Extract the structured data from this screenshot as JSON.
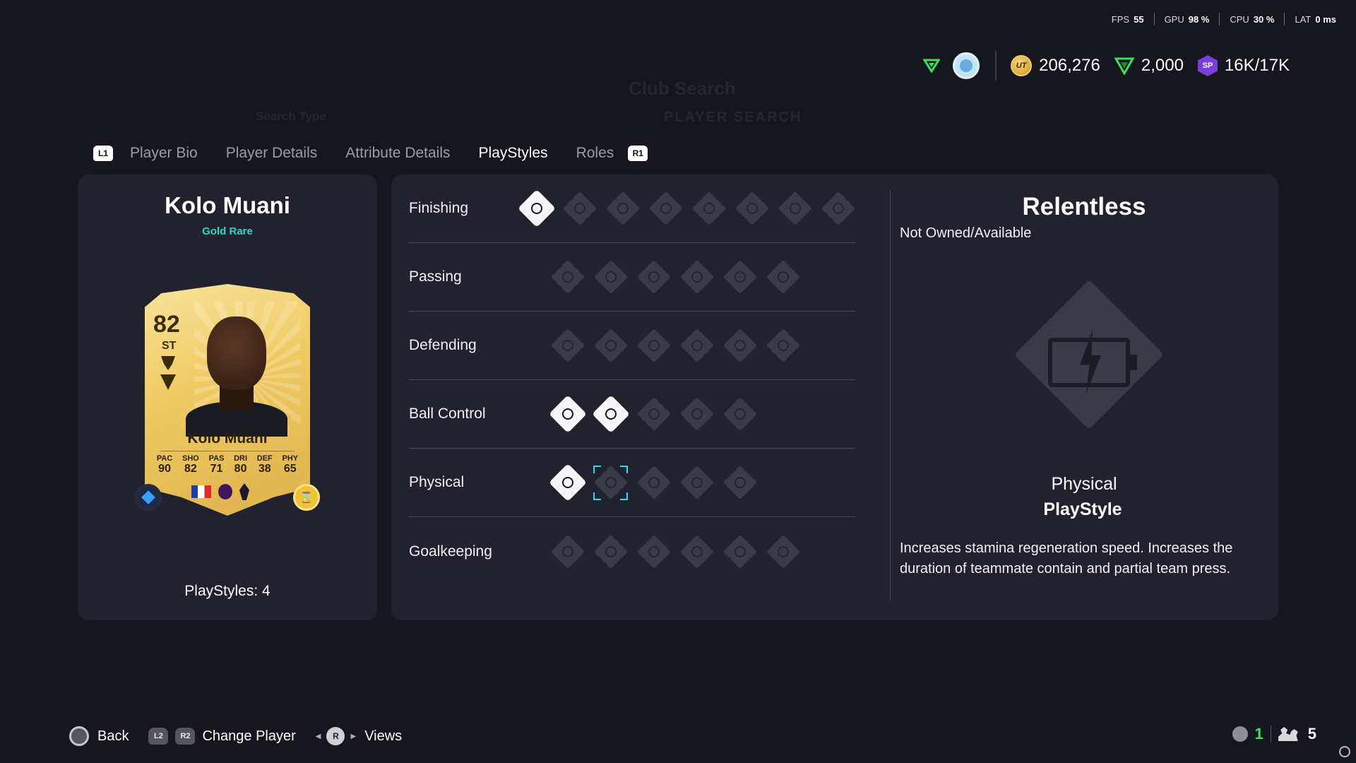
{
  "perf": {
    "fps_label": "FPS",
    "fps": "55",
    "gpu_label": "GPU",
    "gpu": "98 %",
    "cpu_label": "CPU",
    "cpu": "30 %",
    "lat_label": "LAT",
    "lat": "0 ms"
  },
  "ghost": {
    "title": "Club Search",
    "subtitle": "PLAYER SEARCH",
    "label": "Search Type"
  },
  "currency": {
    "coins_icon_text": "UT",
    "coins": "206,276",
    "points": "2,000",
    "sp_icon_text": "SP",
    "sp": "16K/17K"
  },
  "tabs": {
    "left_shoulder": "L1",
    "right_shoulder": "R1",
    "items": [
      "Player Bio",
      "Player Details",
      "Attribute Details",
      "PlayStyles",
      "Roles"
    ],
    "active": "PlayStyles"
  },
  "player": {
    "name": "Kolo Muani",
    "rarity": "Gold Rare",
    "playstyles_count": "PlayStyles: 4",
    "card": {
      "rating": "82",
      "position": "ST",
      "name": "Kolo Muani",
      "stats": [
        {
          "k": "PAC",
          "v": "90"
        },
        {
          "k": "SHO",
          "v": "82"
        },
        {
          "k": "PAS",
          "v": "71"
        },
        {
          "k": "DRI",
          "v": "80"
        },
        {
          "k": "DEF",
          "v": "38"
        },
        {
          "k": "PHY",
          "v": "65"
        }
      ]
    }
  },
  "categories": [
    {
      "label": "Finishing",
      "count": 8,
      "owned": [
        0
      ],
      "selected": -1
    },
    {
      "label": "Passing",
      "count": 6,
      "owned": [],
      "selected": -1
    },
    {
      "label": "Defending",
      "count": 6,
      "owned": [],
      "selected": -1
    },
    {
      "label": "Ball Control",
      "count": 5,
      "owned": [
        0,
        1
      ],
      "selected": -1
    },
    {
      "label": "Physical",
      "count": 5,
      "owned": [
        0
      ],
      "selected": 1
    },
    {
      "label": "Goalkeeping",
      "count": 6,
      "owned": [],
      "selected": -1
    }
  ],
  "detail": {
    "title": "Relentless",
    "status": "Not Owned/Available",
    "category": "Physical",
    "type": "PlayStyle",
    "description": "Increases stamina regeneration speed. Increases the duration of teammate contain and partial team press."
  },
  "footer": {
    "back": "Back",
    "l2": "L2",
    "r2": "R2",
    "change_player": "Change Player",
    "r_stick": "R",
    "views": "Views"
  },
  "social": {
    "online": "1",
    "friends": "5"
  },
  "colors": {
    "background": "#16161f",
    "panel": "#22222e",
    "accent_teal": "#2ed8c5",
    "selection": "#2ed8f0",
    "online_green": "#3ee05a"
  }
}
